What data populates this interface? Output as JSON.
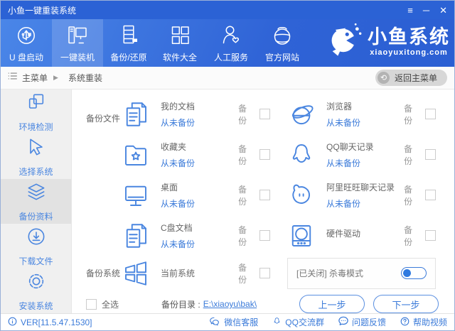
{
  "window": {
    "title": "小鱼一键重装系统",
    "controls": {
      "menu": "≡",
      "minimize": "─",
      "close": "✕"
    }
  },
  "nav": {
    "items": [
      {
        "label": "U 盘启动",
        "icon": "usb-icon",
        "active": false
      },
      {
        "label": "一键装机",
        "icon": "computer-icon",
        "active": true
      },
      {
        "label": "备份/还原",
        "icon": "server-icon",
        "active": false
      },
      {
        "label": "软件大全",
        "icon": "apps-grid-icon",
        "active": false
      },
      {
        "label": "人工服务",
        "icon": "person-icon",
        "active": false
      },
      {
        "label": "官方网站",
        "icon": "globe-icon",
        "active": false
      }
    ],
    "logo": {
      "name": "小鱼系统",
      "url": "xiaoyuxitong.com"
    }
  },
  "breadcrumb": {
    "home": "主菜单",
    "separator": "▶",
    "current": "系统重装",
    "back_label": "返回主菜单"
  },
  "sidebar": {
    "items": [
      {
        "label": "环境检测",
        "icon": "windows-overlap-icon",
        "active": false
      },
      {
        "label": "选择系统",
        "icon": "cursor-icon",
        "active": false
      },
      {
        "label": "备份资料",
        "icon": "layers-icon",
        "active": true
      },
      {
        "label": "下载文件",
        "icon": "download-icon",
        "active": false
      },
      {
        "label": "安装系统",
        "icon": "gear-icon",
        "active": false
      }
    ]
  },
  "main": {
    "files_section_label": "备份文件",
    "system_section_label": "备份系统",
    "backup_label": "备份",
    "items_left": [
      {
        "label": "我的文档",
        "status": "从未备份",
        "icon": "documents-icon"
      },
      {
        "label": "收藏夹",
        "status": "从未备份",
        "icon": "folder-star-icon"
      },
      {
        "label": "桌面",
        "status": "从未备份",
        "icon": "monitor-icon"
      },
      {
        "label": "C盘文档",
        "status": "从未备份",
        "icon": "documents-icon"
      }
    ],
    "items_right": [
      {
        "label": "浏览器",
        "status": "从未备份",
        "icon": "browser-icon"
      },
      {
        "label": "QQ聊天记录",
        "status": "从未备份",
        "icon": "qq-icon"
      },
      {
        "label": "阿里旺旺聊天记录",
        "status": "从未备份",
        "icon": "wangwang-icon"
      },
      {
        "label": "硬件驱动",
        "status": "",
        "icon": "hardware-icon"
      }
    ],
    "system_item": {
      "label": "当前系统",
      "icon": "windows-logo-icon"
    },
    "antivirus": {
      "label": "[已关闭] 杀毒模式",
      "enabled": false
    },
    "select_all_label": "全选",
    "backup_dir_label": "备份目录 :",
    "backup_dir_value": "E:\\xiaoyu\\bak\\",
    "prev_label": "上一步",
    "next_label": "下一步"
  },
  "footer": {
    "version": "VER[11.5.47.1530]",
    "links": [
      {
        "label": "微信客服",
        "icon": "wechat-icon"
      },
      {
        "label": "QQ交流群",
        "icon": "qq-icon"
      },
      {
        "label": "问题反馈",
        "icon": "feedback-bubble-icon"
      },
      {
        "label": "帮助视频",
        "icon": "help-circle-icon"
      }
    ]
  },
  "colors": {
    "accent": "#4a86e0",
    "titlebar": "#2b62d5",
    "link": "#3a7ad9",
    "nav_gradient_start": "#4a86e8",
    "nav_gradient_end": "#2b5fd3"
  }
}
